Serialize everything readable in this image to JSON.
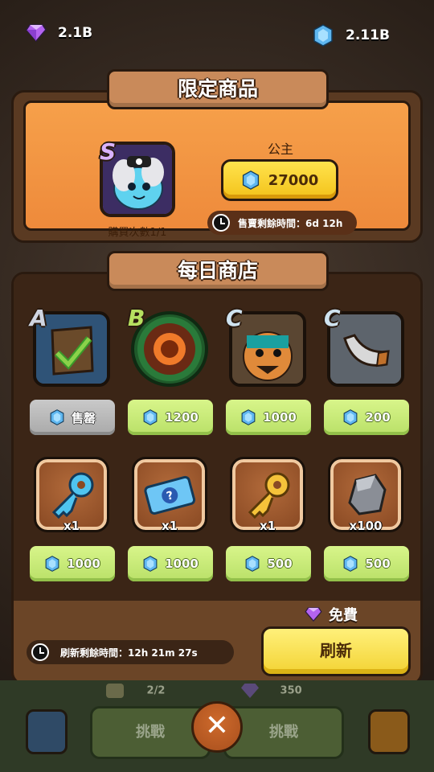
{
  "currencies": {
    "gems": "2.1B",
    "crystals": "2.11B"
  },
  "limited_shop": {
    "title": "限定商品",
    "hero_rank": "S",
    "hero_name": "公主",
    "price": "27000",
    "purchase_count": "購買次數1/1",
    "time_left": "售賣剩餘時間：6d 12h"
  },
  "daily_shop": {
    "title": "每日商店",
    "items": [
      {
        "rank": "A",
        "price": "售罄",
        "sold_out": true,
        "icon": "armor-sold-icon"
      },
      {
        "rank": "B",
        "price": "1200",
        "sold_out": false,
        "icon": "fire-skill-icon"
      },
      {
        "rank": "C",
        "price": "1000",
        "sold_out": false,
        "icon": "ninja-hero-icon"
      },
      {
        "rank": "C",
        "price": "200",
        "sold_out": false,
        "icon": "horn-icon"
      }
    ],
    "consumables": [
      {
        "qty": "x1",
        "price": "1000",
        "icon": "blue-key-icon"
      },
      {
        "qty": "x1",
        "price": "1000",
        "icon": "mystery-ticket-icon"
      },
      {
        "qty": "x1",
        "price": "500",
        "icon": "gold-key-icon"
      },
      {
        "qty": "x100",
        "price": "500",
        "icon": "ore-icon"
      }
    ],
    "free_label": "免費",
    "refresh_label": "刷新",
    "refresh_timer": "刷新剩餘時間：12h 21m 27s"
  },
  "bottom_bar": {
    "left_stat": "2/2",
    "right_stat": "350",
    "challenge_left": "挑戰",
    "challenge_right": "挑戰",
    "close": "✕"
  },
  "colors": {
    "panel": "#5a3a22",
    "price_green": "#c8eb78",
    "gold": "#f3c21a",
    "accent_orange": "#ee8a3b"
  }
}
